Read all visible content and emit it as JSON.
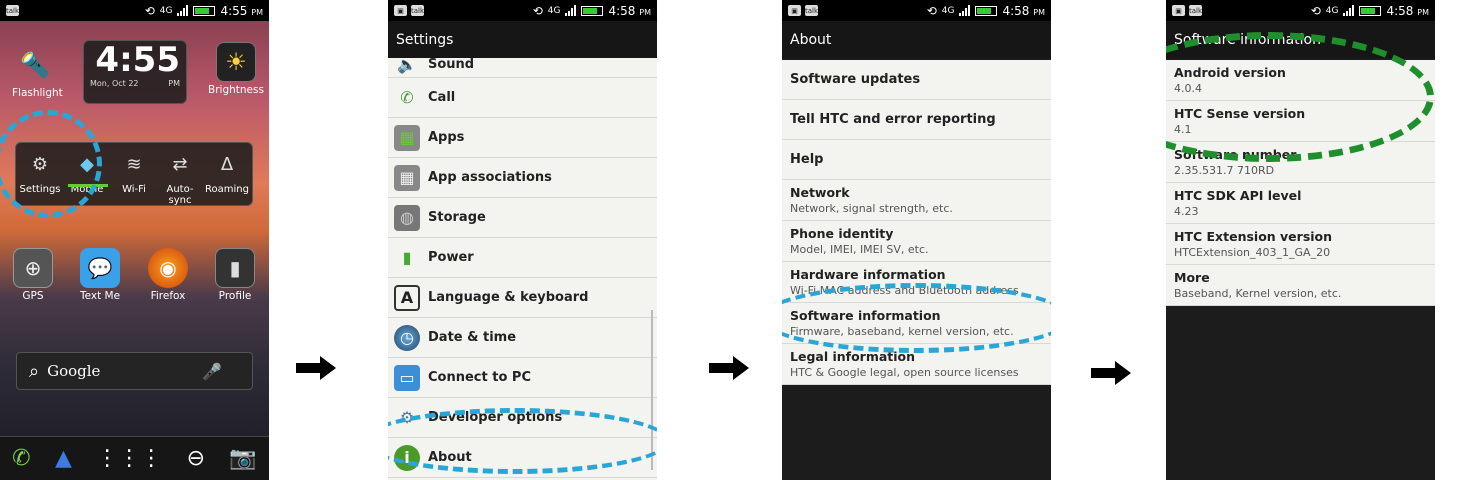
{
  "statusbar": {
    "talk_label": "talk",
    "network": "4G",
    "time1": "4:55",
    "time2": "4:58",
    "ampm": "PM"
  },
  "home": {
    "clock_time": "4:55",
    "clock_date": "Mon, Oct 22",
    "clock_ampm": "PM",
    "flashlight": "Flashlight",
    "brightness": "Brightness",
    "quick_settings": [
      "Settings",
      "Mobile",
      "Wi-Fi",
      "Auto-sync",
      "Roaming"
    ],
    "apps": [
      "GPS",
      "Text Me",
      "Firefox",
      "Profile"
    ],
    "search_label": "Google"
  },
  "settings": {
    "title": "Settings",
    "items": [
      "Sound",
      "Call",
      "Apps",
      "App associations",
      "Storage",
      "Power",
      "Language & keyboard",
      "Date & time",
      "Connect to PC",
      "Developer options",
      "About"
    ]
  },
  "about": {
    "title": "About",
    "single_items": [
      "Software updates",
      "Tell HTC and error reporting",
      "Help"
    ],
    "items": [
      {
        "title": "Network",
        "sub": "Network, signal strength, etc."
      },
      {
        "title": "Phone identity",
        "sub": "Model, IMEI, IMEI SV, etc."
      },
      {
        "title": "Hardware information",
        "sub": "Wi-Fi MAC address and Bluetooth address"
      },
      {
        "title": "Software information",
        "sub": "Firmware, baseband, kernel version, etc."
      },
      {
        "title": "Legal information",
        "sub": "HTC & Google legal, open source licenses"
      }
    ]
  },
  "software": {
    "title": "Software information",
    "items": [
      {
        "title": "Android version",
        "sub": "4.0.4"
      },
      {
        "title": "HTC Sense version",
        "sub": "4.1"
      },
      {
        "title": "Software number",
        "sub": "2.35.531.7 710RD"
      },
      {
        "title": "HTC SDK API level",
        "sub": "4.23"
      },
      {
        "title": "HTC Extension version",
        "sub": "HTCExtension_403_1_GA_20"
      },
      {
        "title": "More",
        "sub": "Baseband, Kernel version, etc."
      }
    ]
  },
  "colors": {
    "highlight_blue": "#2aa6d6",
    "highlight_green": "#1e8f2c"
  }
}
